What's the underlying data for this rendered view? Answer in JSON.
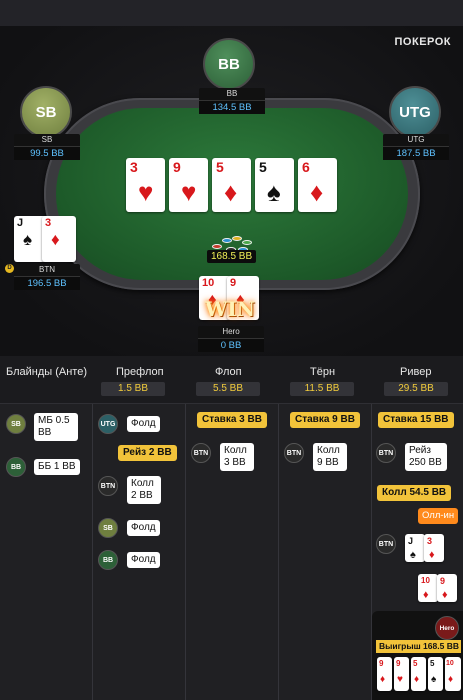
{
  "brand": {
    "logo": "ПОКЕРОК"
  },
  "seats": {
    "bb": {
      "circle": "BB",
      "name": "BB",
      "stack": "134.5 BB"
    },
    "sb": {
      "circle": "SB",
      "name": "SB",
      "stack": "99.5 BB"
    },
    "utg": {
      "circle": "UTG",
      "name": "UTG",
      "stack": "187.5 BB"
    },
    "btn": {
      "name": "BTN",
      "stack": "196.5 BB",
      "cards": [
        {
          "rank": "J",
          "suit": "♠"
        },
        {
          "rank": "3",
          "suit": "♦"
        }
      ]
    },
    "hero": {
      "name": "Hero",
      "stack": "0 BB",
      "cards": [
        {
          "rank": "10",
          "suit": "♦"
        },
        {
          "rank": "9",
          "suit": "♦"
        }
      ],
      "badge": "WIN"
    }
  },
  "board": [
    {
      "rank": "3",
      "suit": "♥",
      "color": "red"
    },
    {
      "rank": "9",
      "suit": "♥",
      "color": "red"
    },
    {
      "rank": "5",
      "suit": "♦",
      "color": "red"
    },
    {
      "rank": "5",
      "suit": "♠",
      "color": "blk"
    },
    {
      "rank": "6",
      "suit": "♦",
      "color": "red"
    }
  ],
  "pot": "168.5 BB",
  "dealer_button": "D",
  "history": {
    "columns": [
      {
        "title": "Блайнды (Анте)",
        "pot": ""
      },
      {
        "title": "Префлоп",
        "pot": "1.5 BB"
      },
      {
        "title": "Флоп",
        "pot": "5.5 BB"
      },
      {
        "title": "Тёрн",
        "pot": "11.5 BB"
      },
      {
        "title": "Ривер",
        "pot": "29.5 BB"
      }
    ],
    "blinds": [
      {
        "pos": "SB",
        "action": "МБ 0.5 BB"
      },
      {
        "pos": "BB",
        "action": "ББ 1 BB"
      }
    ],
    "preflop": [
      {
        "pos": "UTG",
        "action": "Фолд"
      },
      {
        "bet": "Рейз 2 BB"
      },
      {
        "pos": "BTN",
        "action": "Колл 2 BB"
      },
      {
        "pos": "SB",
        "action": "Фолд"
      },
      {
        "pos": "BB",
        "action": "Фолд"
      }
    ],
    "flop": [
      {
        "bet": "Ставка 3 BB"
      },
      {
        "pos": "BTN",
        "action": "Колл 3 BB"
      }
    ],
    "turn": [
      {
        "bet": "Ставка 9 BB"
      },
      {
        "pos": "BTN",
        "action": "Колл 9 BB"
      }
    ],
    "river": [
      {
        "bet": "Ставка 15 BB"
      },
      {
        "pos": "BTN",
        "action": "Рейз 250 BB"
      },
      {
        "bet": "Колл 54.5 BB"
      },
      {
        "tag": "Олл-ин"
      },
      {
        "pos": "BTN",
        "cards": [
          {
            "rank": "J",
            "suit": "♠"
          },
          {
            "rank": "3",
            "suit": "♦"
          }
        ]
      },
      {
        "cards": [
          {
            "rank": "10",
            "suit": "♦"
          },
          {
            "rank": "9",
            "suit": "♦"
          }
        ]
      }
    ],
    "result": {
      "avatar": "Hero",
      "win": "Выигрыш 168.5 BB",
      "cards": [
        {
          "rank": "9",
          "suit": "♦"
        },
        {
          "rank": "9",
          "suit": "♥"
        },
        {
          "rank": "5",
          "suit": "♦"
        },
        {
          "rank": "5",
          "suit": "♠"
        },
        {
          "rank": "10",
          "suit": "♦"
        }
      ]
    }
  }
}
